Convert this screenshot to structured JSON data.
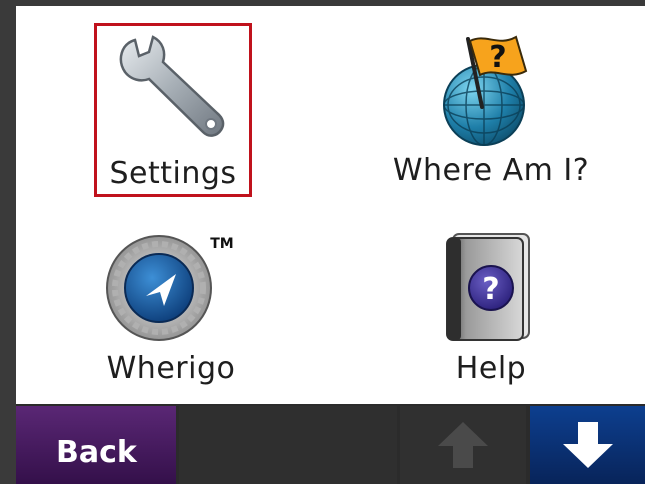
{
  "menu": {
    "items": [
      {
        "label": "Settings",
        "icon": "wrench-icon",
        "selected": true
      },
      {
        "label": "Where Am I?",
        "icon": "globe-flag-icon"
      },
      {
        "label": "Wherigo",
        "icon": "wherigo-icon",
        "badge": "TM"
      },
      {
        "label": "Help",
        "icon": "help-book-icon"
      }
    ]
  },
  "toolbar": {
    "back_label": "Back",
    "up_icon": "arrow-up-icon",
    "down_icon": "arrow-down-icon"
  },
  "colors": {
    "selection": "#c0121c",
    "back_button": "#4a1d63",
    "down_button": "#0d3f8f"
  }
}
